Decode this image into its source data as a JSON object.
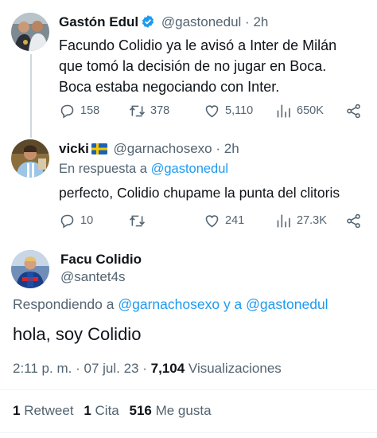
{
  "tweets": [
    {
      "name": "Gastón Edul",
      "handle": "@gastonedul",
      "separator": "·",
      "time": "2h",
      "verified": true,
      "text_lines": [
        "Facundo Colidio ya le avisó a Inter de Milán",
        "que tomó la decisión de no jugar en Boca.",
        "Boca estaba negociando con Inter."
      ],
      "replies": "158",
      "retweets": "378",
      "likes": "5,110",
      "views": "650K"
    },
    {
      "name": "vicki",
      "flag": "sweden-flag",
      "handle": "@garnachosexo",
      "separator": "·",
      "time": "2h",
      "reply_prefix": "En respuesta a",
      "reply_to": "@gastonedul",
      "text": "perfecto, Colidio chupame la punta del clitoris",
      "replies": "10",
      "retweets": "",
      "likes": "241",
      "views": "27.3K"
    }
  ],
  "main": {
    "name": "Facu Colidio",
    "handle": "@santet4s",
    "reply_prefix": "Respondiendo a",
    "reply_to_1": "@garnachosexo",
    "reply_and": "y a",
    "reply_to_2": "@gastonedul",
    "text": "hola, soy Colidio",
    "time": "2:11 p. m.",
    "date": "07 jul. 23",
    "separator": "·",
    "views_count": "7,104",
    "views_label": "Visualizaciones",
    "retweets_count": "1",
    "retweets_label": "Retweet",
    "quotes_count": "1",
    "quotes_label": "Cita",
    "likes_count": "516",
    "likes_label": "Me gusta"
  },
  "colors": {
    "link": "#1d9bf0",
    "secondary_text": "#536471",
    "primary_text": "#0f1419",
    "divider": "#eff3f4"
  },
  "icons": [
    "reply-icon",
    "retweet-icon",
    "like-icon",
    "views-icon",
    "share-icon",
    "verified-badge-icon"
  ]
}
